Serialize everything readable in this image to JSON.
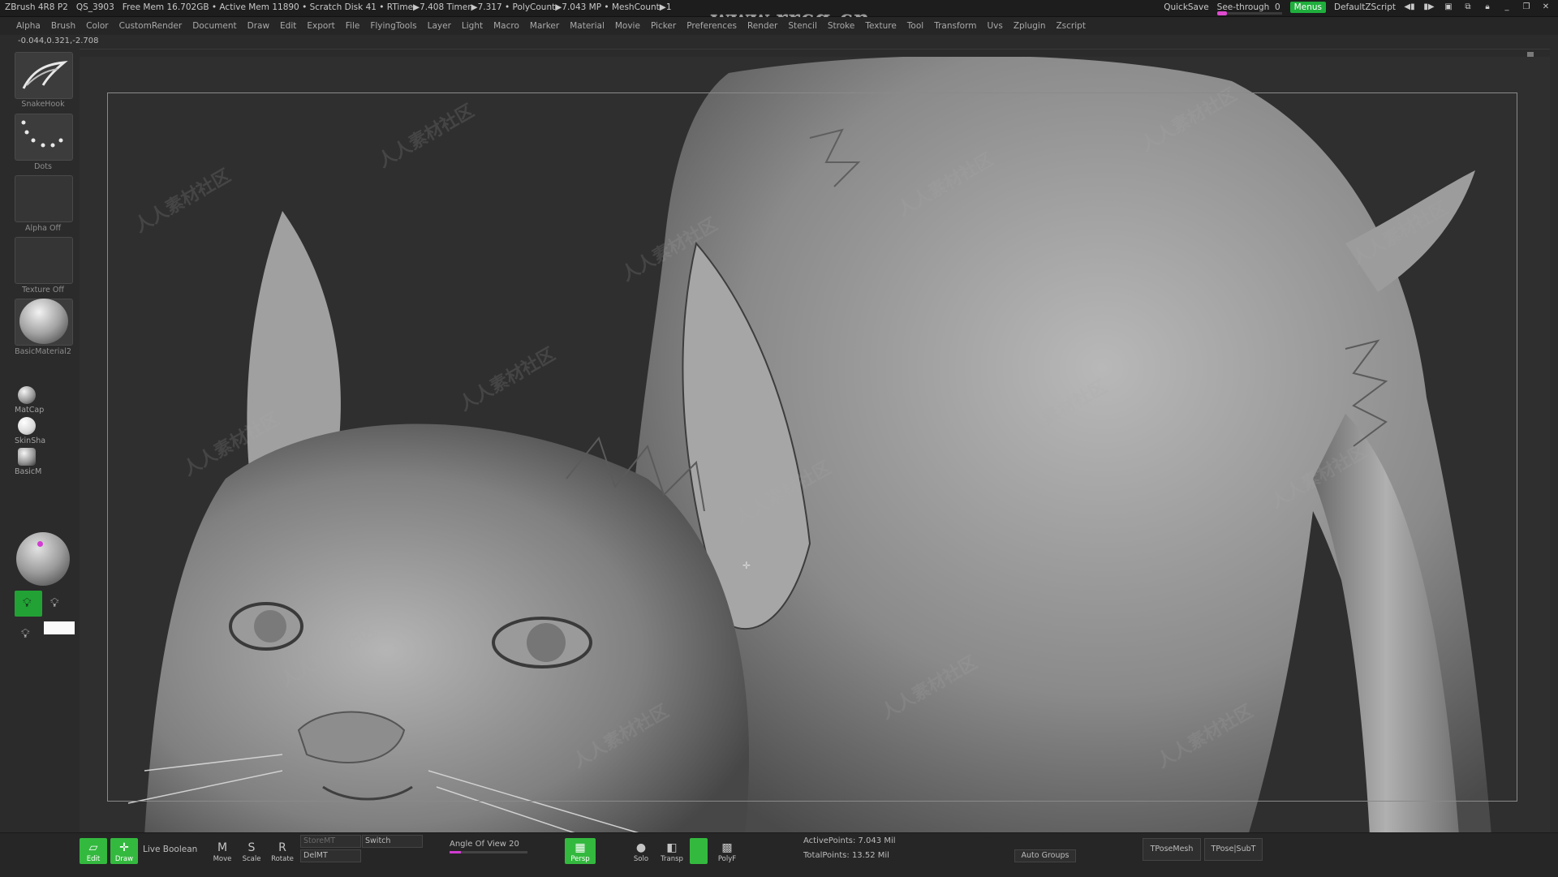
{
  "topbar": {
    "app": "ZBrush 4R8 P2",
    "qs": "QS_3903",
    "mem": "Free Mem 16.702GB • Active Mem 11890 • Scratch Disk 41 • RTime▶7.408 Timer▶7.317 • PolyCount▶7.043 MP • MeshCount▶1",
    "quicksave": "QuickSave",
    "seethrough_label": "See-through",
    "seethrough_value": "0",
    "seethrough_level": 0,
    "menus": "Menus",
    "script": "DefaultZScript",
    "accent": "#1fae3c",
    "slider_color": "#e04ad0"
  },
  "watermark_site": "www.rrcg.cn",
  "watermark_text": "人人素材社区",
  "menu": [
    "Alpha",
    "Brush",
    "Color",
    "CustomRender",
    "Document",
    "Draw",
    "Edit",
    "Export",
    "File",
    "FlyingTools",
    "Layer",
    "Light",
    "Macro",
    "Marker",
    "Material",
    "Movie",
    "Picker",
    "Preferences",
    "Render",
    "Stencil",
    "Stroke",
    "Texture",
    "Tool",
    "Transform",
    "Uvs",
    "Zplugin",
    "Zscript"
  ],
  "coords": "-0.044,0.321,-2.708",
  "left": {
    "brush_label": "SnakeHook",
    "stroke_label": "Dots",
    "alpha_label": "Alpha Off",
    "texture_label": "Texture Off",
    "material_label": "BasicMaterial2",
    "mat1": "MatCap",
    "mat2": "SkinSha",
    "mat3": "BasicM",
    "color_dot": "#d33bd3",
    "secondary_color": "#fafafa"
  },
  "bottom": {
    "edit": "Edit",
    "draw": "Draw",
    "live_boolean": "Live Boolean",
    "move": "Move",
    "scale": "Scale",
    "rotate": "Rotate",
    "store_mt": "StoreMT",
    "del_mt": "DelMT",
    "switch": "Switch",
    "angle_label": "Angle Of View 20",
    "angle_level": 0.15,
    "persp": "Persp",
    "solo": "Solo",
    "transp": "Transp",
    "polyf": "PolyF",
    "active_points": "ActivePoints: 7.043 Mil",
    "total_points": "TotalPoints: 13.52 Mil",
    "auto_groups": "Auto Groups",
    "tpose_mesh": "TPoseMesh",
    "tpose_subt": "TPose|SubT"
  }
}
